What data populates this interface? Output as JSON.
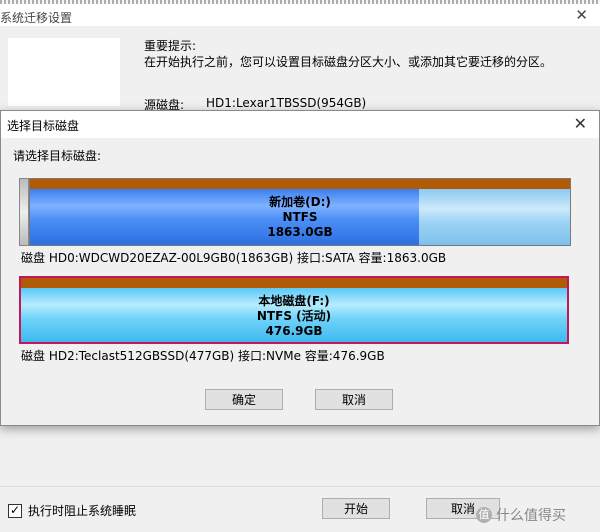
{
  "background": {
    "title": "系统迁移设置",
    "notice_title": "重要提示:",
    "notice_text": "在开始执行之前，您可以设置目标磁盘分区大小、或添加其它要迁移的分区。",
    "source_label": "源磁盘:",
    "source_value": "HD1:Lexar1TBSSD(954GB)",
    "prevent_sleep_label": "执行时阻止系统睡眠",
    "prevent_sleep_checked": true,
    "start_button": "开始",
    "cancel_button": "取消",
    "close_glyph": "✕"
  },
  "dialog": {
    "title": "选择目标磁盘",
    "close_glyph": "✕",
    "prompt": "请选择目标磁盘:",
    "disks": [
      {
        "partition_name": "新加卷(D:)",
        "filesystem": "NTFS",
        "size": "1863.0GB",
        "used_fraction": 0.72,
        "info": "磁盘 HD0:WDCWD20EZAZ-00L9GB0(1863GB)  接口:SATA  容量:1863.0GB",
        "selected": false
      },
      {
        "partition_name": "本地磁盘(F:)",
        "filesystem": "NTFS (活动)",
        "size": "476.9GB",
        "used_fraction": 1.0,
        "info": "磁盘 HD2:Teclast512GBSSD(477GB)  接口:NVMe  容量:476.9GB",
        "selected": true
      }
    ],
    "ok_button": "确定",
    "cancel_button": "取消"
  },
  "watermark": {
    "badge": "值",
    "text": "什么值得买"
  },
  "colors": {
    "partition_cap": "#b25a06",
    "selected_border": "#c2185b",
    "ntfs_blue": "#3a7ff0",
    "ntfs_cyan": "#5ac9f6"
  }
}
